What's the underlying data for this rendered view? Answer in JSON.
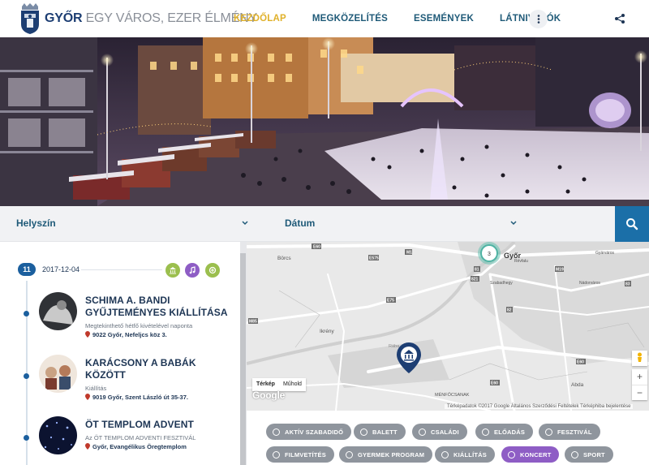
{
  "header": {
    "brand_city": "GYŐR",
    "brand_slogan": "EGY VÁROS, EZER ÉLMÉNY",
    "nav": [
      {
        "label": "KEZDŐLAP",
        "active": true
      },
      {
        "label": "MEGKÖZELÍTÉS",
        "active": false
      },
      {
        "label": "ESEMÉNYEK",
        "active": false
      },
      {
        "label": "LÁTNIVALÓK",
        "active": false
      }
    ]
  },
  "filter": {
    "location_label": "Helyszín",
    "date_label": "Dátum"
  },
  "events": {
    "day_badge": "11",
    "date": "2017-12-04",
    "items": [
      {
        "title_line1": "SCHIMA A. BANDI",
        "title_line2": "GYŰJTEMÉNYES KIÁLLÍTÁSA",
        "subtitle": "Megtekinthető hétfő kivételével naponta",
        "address": "9022 Győr, Nefeljcs köz 3."
      },
      {
        "title_line1": "KARÁCSONY A BABÁK",
        "title_line2": "KÖZÖTT",
        "subtitle": "Kiállítás",
        "address": "9019 Győr, Szent László út 35-37."
      },
      {
        "title_line1": "ÖT TEMPLOM ADVENT",
        "title_line2": "",
        "subtitle": "Az ÖT TEMPLOM ADVENTI FESZTIVÁL",
        "address": "Győr, Evangélikus Öregtemplom"
      }
    ]
  },
  "map": {
    "tab_map": "Térkép",
    "tab_satellite": "Műhold",
    "city_label": "Győr",
    "cluster_count": "3",
    "places": [
      "Börcs",
      "Ikrény",
      "MÉNFŐCSANAK",
      "Abda",
      "Rába",
      "Szabadhegy",
      "Nádorváros",
      "Gyárváros",
      "Révfalu"
    ],
    "roads": [
      "E60",
      "E575",
      "M1",
      "M19",
      "E75",
      "E60",
      "82",
      "81",
      "83",
      "821",
      "E60",
      "M85"
    ],
    "google": "Google",
    "footer": "Térképadatok ©2017 Google    Általános Szerződési Feltételek    Térképhiba bejelentése"
  },
  "tags": [
    {
      "label": "AKTÍV SZABADIDŐ",
      "highlight": false
    },
    {
      "label": "BALETT",
      "highlight": false
    },
    {
      "label": "CSALÁDI",
      "highlight": false
    },
    {
      "label": "ELŐADÁS",
      "highlight": false
    },
    {
      "label": "FESZTIVÁL",
      "highlight": false
    },
    {
      "label": "FILMVETÍTÉS",
      "highlight": false
    },
    {
      "label": "GYERMEK PROGRAM",
      "highlight": false
    },
    {
      "label": "KIÁLLÍTÁS",
      "highlight": false
    },
    {
      "label": "KONCERT",
      "highlight": true
    },
    {
      "label": "SPORT",
      "highlight": false
    }
  ],
  "colors": {
    "primary": "#1b6fa8",
    "accent": "#e0b12a",
    "highlight_tag": "#8e5dc5",
    "tag_grey": "#8f959d"
  }
}
